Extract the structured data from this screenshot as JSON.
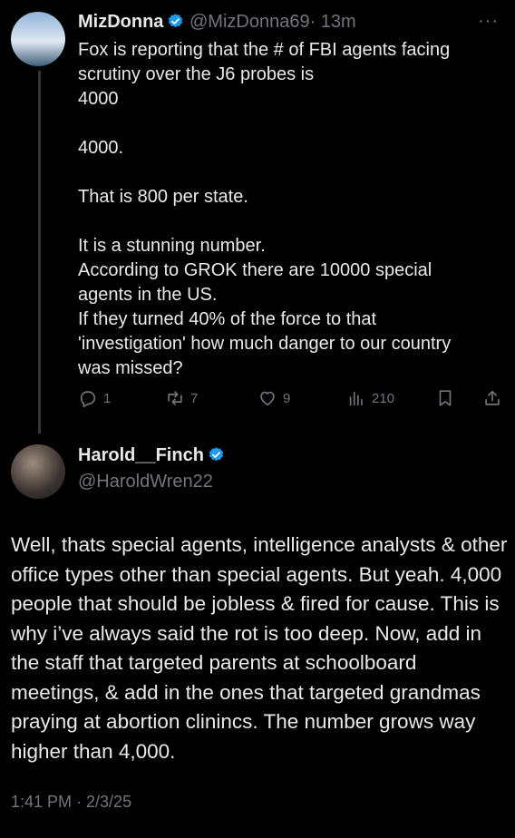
{
  "tweet1": {
    "name": "MizDonna",
    "handle": "@MizDonna69",
    "time": "· 13m",
    "more": "···",
    "text": "Fox is reporting that the # of FBI agents facing\nscrutiny over the J6 probes is\n4000\n\n4000.\n\nThat is 800 per state.\n\nIt is a stunning number.\nAccording to GROK there are 10000 special\nagents in the US.\nIf they turned 40% of the force to that\n'investigation' how much danger to our country\nwas missed?",
    "replies": "1",
    "reposts": "7",
    "likes": "9",
    "views": "210"
  },
  "tweet2": {
    "name": "Harold__Finch",
    "handle": "@HaroldWren22",
    "text": "Well, thats special agents, intelligence analysts & other office types other than special agents. But yeah. 4,000 people that should be jobless & fired for cause. This is why i’ve always said the rot is too deep. Now, add in the staff that targeted parents at schoolboard meetings, & add in the ones that targeted grandmas praying at abortion clinincs. The number grows way higher than 4,000.",
    "timestamp": "1:41 PM · 2/3/25"
  },
  "colors": {
    "verified": "#1d9bf0",
    "muted": "#71767b",
    "text": "#e7e9ea"
  }
}
